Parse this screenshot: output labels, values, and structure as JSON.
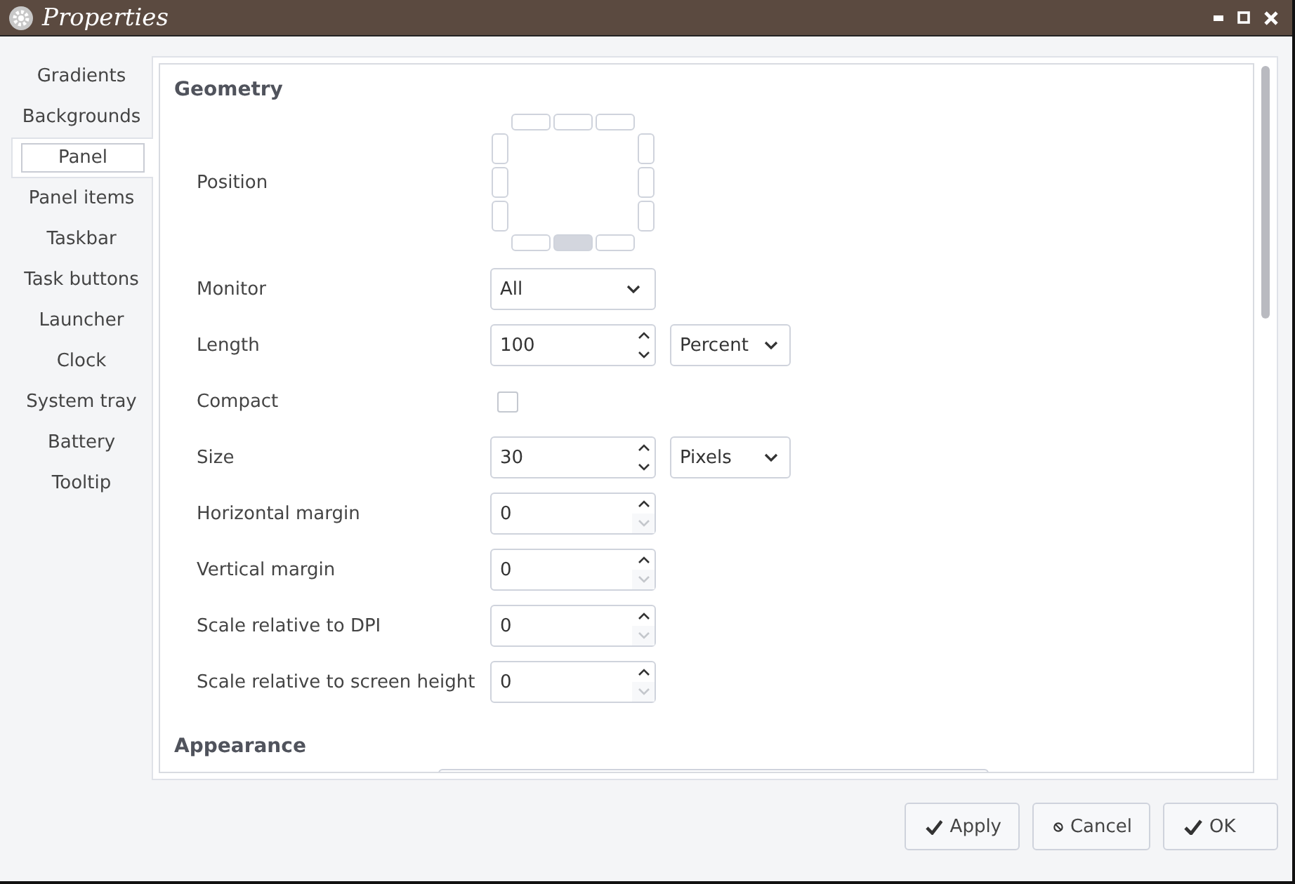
{
  "window": {
    "title": "Properties"
  },
  "sidebar": {
    "items": [
      {
        "label": "Gradients",
        "selected": false
      },
      {
        "label": "Backgrounds",
        "selected": false
      },
      {
        "label": "Panel",
        "selected": true
      },
      {
        "label": "Panel items",
        "selected": false
      },
      {
        "label": "Taskbar",
        "selected": false
      },
      {
        "label": "Task buttons",
        "selected": false
      },
      {
        "label": "Launcher",
        "selected": false
      },
      {
        "label": "Clock",
        "selected": false
      },
      {
        "label": "System tray",
        "selected": false
      },
      {
        "label": "Battery",
        "selected": false
      },
      {
        "label": "Tooltip",
        "selected": false
      }
    ]
  },
  "geometry": {
    "heading": "Geometry",
    "position": {
      "label": "Position",
      "slots": [
        {
          "selected": false
        },
        {
          "selected": false
        },
        {
          "selected": false
        },
        {
          "selected": false
        },
        {
          "selected": false
        },
        {
          "selected": false
        },
        {
          "selected": false
        },
        {
          "selected": false
        },
        {
          "selected": false
        },
        {
          "selected": false
        },
        {
          "selected": true
        },
        {
          "selected": false
        }
      ]
    },
    "fields": [
      {
        "kind": "dropdown",
        "label": "Monitor",
        "value": "All"
      },
      {
        "kind": "spin",
        "label": "Length",
        "value": "100",
        "down_disabled": false,
        "unit": "Percent"
      },
      {
        "kind": "checkbox",
        "label": "Compact",
        "checked": false
      },
      {
        "kind": "spin",
        "label": "Size",
        "value": "30",
        "down_disabled": false,
        "unit": "Pixels"
      },
      {
        "kind": "spin",
        "label": "Horizontal margin",
        "value": "0",
        "down_disabled": true
      },
      {
        "kind": "spin",
        "label": "Vertical margin",
        "value": "0",
        "down_disabled": true
      },
      {
        "kind": "spin",
        "label": "Scale relative to DPI",
        "value": "0",
        "down_disabled": true
      },
      {
        "kind": "spin",
        "label": "Scale relative to screen height",
        "value": "0",
        "down_disabled": true
      }
    ]
  },
  "appearance": {
    "heading": "Appearance"
  },
  "buttons": [
    {
      "kind": "check",
      "label": "Apply"
    },
    {
      "kind": "cancel",
      "label": "Cancel"
    },
    {
      "kind": "check",
      "label": "OK"
    }
  ]
}
